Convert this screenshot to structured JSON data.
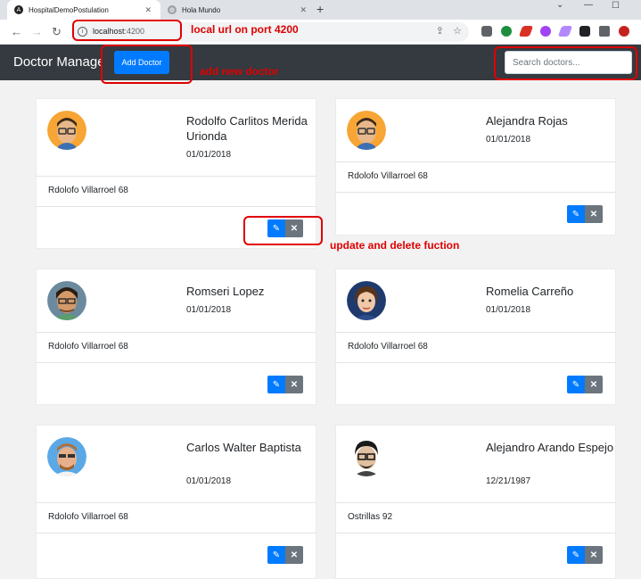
{
  "browser": {
    "tabs": [
      {
        "title": "HospitalDemoPostulation",
        "active": true,
        "favicon": "angular-icon"
      },
      {
        "title": "Hola Mundo",
        "active": false,
        "favicon": "globe-icon"
      }
    ],
    "url_host": "localhost",
    "url_port": ":4200"
  },
  "app": {
    "brand": "Doctor Manager",
    "add_button": "Add Doctor",
    "search_placeholder": "Search doctors...",
    "primary_color": "#007bff",
    "secondary_color": "#6c757d",
    "navbar_color": "#343a40"
  },
  "doctors": [
    {
      "name": "Rodolfo Carlitos Merida Urionda",
      "date": "01/01/2018",
      "address": "Rdolofo Villarroel 68"
    },
    {
      "name": "Alejandra Rojas",
      "date": "01/01/2018",
      "address": "Rdolofo Villarroel 68"
    },
    {
      "name": "Romseri Lopez",
      "date": "01/01/2018",
      "address": "Rdolofo Villarroel 68"
    },
    {
      "name": "Romelia Carreño",
      "date": "01/01/2018",
      "address": "Rdolofo Villarroel 68"
    },
    {
      "name": "Carlos Walter Baptista",
      "date": "01/01/2018",
      "address": "Rdolofo Villarroel 68"
    },
    {
      "name": "Alejandro Arando Espejo",
      "date": "12/21/1987",
      "address": "Ostrillas 92"
    }
  ],
  "annotations": {
    "url_note": "local url on port 4200",
    "add_note": "add new doctor",
    "actions_note": "update and delete fuction"
  }
}
